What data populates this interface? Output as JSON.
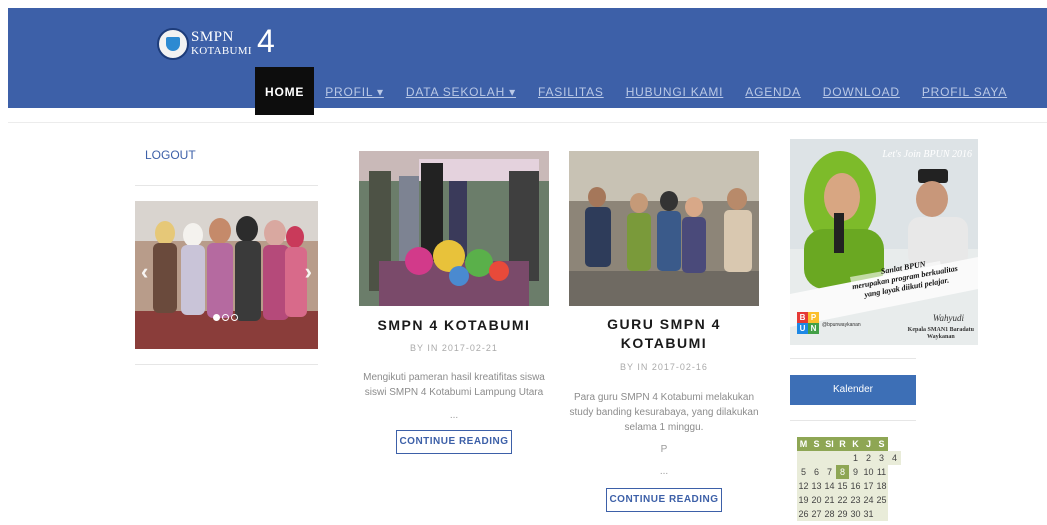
{
  "header": {
    "logo_line1": "SMPN",
    "logo_line2": "KOTABUMI",
    "logo_number": "4"
  },
  "nav": {
    "items": [
      {
        "label": "HOME",
        "active": true
      },
      {
        "label": "PROFIL ▾"
      },
      {
        "label": "DATA SEKOLAH ▾"
      },
      {
        "label": "FASILITAS"
      },
      {
        "label": "HUBUNGI KAMI"
      },
      {
        "label": "AGENDA"
      },
      {
        "label": "DOWNLOAD"
      },
      {
        "label": "PROFIL SAYA"
      }
    ]
  },
  "sidebar_left": {
    "logout_label": "LOGOUT",
    "slider": {
      "prev_icon": "chevron-left-icon",
      "next_icon": "chevron-right-icon",
      "slide_count": 3,
      "active_slide": 1
    }
  },
  "posts": [
    {
      "title": "SMPN 4 KOTABUMI",
      "meta": "BY IN 2017-02-21",
      "excerpt": "Mengikuti pameran hasil kreatifitas siswa siswi SMPN 4 Kotabumi Lampung Utara",
      "ellipsis": "...",
      "button_label": "CONTINUE READING"
    },
    {
      "title": "GURU SMPN 4 KOTABUMI",
      "meta": "BY IN 2017-02-16",
      "excerpt": "Para guru SMPN 4 Kotabumi melakukan study banding kesurabaya, yang dilakukan selama 1 minggu.",
      "extra": "P",
      "ellipsis": "...",
      "button_label": "CONTINUE READING"
    }
  ],
  "sidebar_right": {
    "banner": {
      "top_text": "Let's Join BPUN 2016",
      "slogan_line1": "Sanlat BPUN",
      "slogan_line2": "merupakan program berkualitas",
      "slogan_line3": "yang layak diikuti pelajar.",
      "signature": "Wahyudi",
      "caption_line1": "Kepala SMAN1 Baradatu",
      "caption_line2": "Waykanan",
      "handle": "@bpunwaykanan",
      "badge_letters": [
        "B",
        "P",
        "U",
        "N"
      ]
    },
    "kalender_label": "Kalender",
    "calendar": {
      "days": [
        "M",
        "S",
        "Sl",
        "R",
        "K",
        "J",
        "S"
      ],
      "weeks": [
        [
          "",
          "",
          "",
          "",
          "1",
          "2",
          "3",
          "4"
        ],
        [
          "5",
          "6",
          "7",
          "8",
          "9",
          "10",
          "11"
        ],
        [
          "12",
          "13",
          "14",
          "15",
          "16",
          "17",
          "18"
        ],
        [
          "19",
          "20",
          "21",
          "22",
          "23",
          "24",
          "25"
        ],
        [
          "26",
          "27",
          "28",
          "29",
          "30",
          "31",
          ""
        ]
      ],
      "today": "8"
    },
    "colors": {
      "header": "#3d60a8",
      "calendar_head": "#8ea654",
      "calendar_cell": "#e9ecd9"
    }
  }
}
